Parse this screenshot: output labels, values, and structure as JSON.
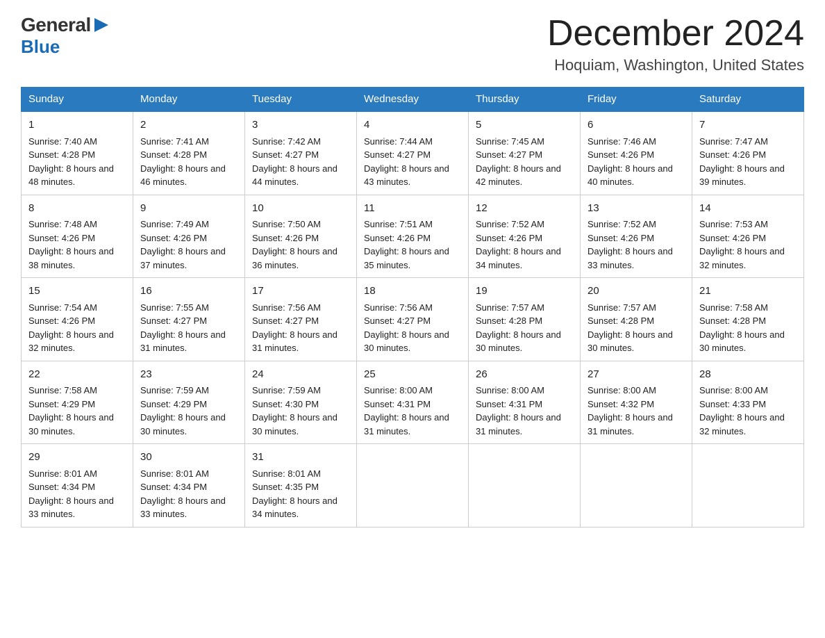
{
  "header": {
    "logo_general": "General",
    "logo_blue": "Blue",
    "month_title": "December 2024",
    "location": "Hoquiam, Washington, United States"
  },
  "days_of_week": [
    "Sunday",
    "Monday",
    "Tuesday",
    "Wednesday",
    "Thursday",
    "Friday",
    "Saturday"
  ],
  "weeks": [
    [
      {
        "day": "1",
        "sunrise": "7:40 AM",
        "sunset": "4:28 PM",
        "daylight": "8 hours and 48 minutes."
      },
      {
        "day": "2",
        "sunrise": "7:41 AM",
        "sunset": "4:28 PM",
        "daylight": "8 hours and 46 minutes."
      },
      {
        "day": "3",
        "sunrise": "7:42 AM",
        "sunset": "4:27 PM",
        "daylight": "8 hours and 44 minutes."
      },
      {
        "day": "4",
        "sunrise": "7:44 AM",
        "sunset": "4:27 PM",
        "daylight": "8 hours and 43 minutes."
      },
      {
        "day": "5",
        "sunrise": "7:45 AM",
        "sunset": "4:27 PM",
        "daylight": "8 hours and 42 minutes."
      },
      {
        "day": "6",
        "sunrise": "7:46 AM",
        "sunset": "4:26 PM",
        "daylight": "8 hours and 40 minutes."
      },
      {
        "day": "7",
        "sunrise": "7:47 AM",
        "sunset": "4:26 PM",
        "daylight": "8 hours and 39 minutes."
      }
    ],
    [
      {
        "day": "8",
        "sunrise": "7:48 AM",
        "sunset": "4:26 PM",
        "daylight": "8 hours and 38 minutes."
      },
      {
        "day": "9",
        "sunrise": "7:49 AM",
        "sunset": "4:26 PM",
        "daylight": "8 hours and 37 minutes."
      },
      {
        "day": "10",
        "sunrise": "7:50 AM",
        "sunset": "4:26 PM",
        "daylight": "8 hours and 36 minutes."
      },
      {
        "day": "11",
        "sunrise": "7:51 AM",
        "sunset": "4:26 PM",
        "daylight": "8 hours and 35 minutes."
      },
      {
        "day": "12",
        "sunrise": "7:52 AM",
        "sunset": "4:26 PM",
        "daylight": "8 hours and 34 minutes."
      },
      {
        "day": "13",
        "sunrise": "7:52 AM",
        "sunset": "4:26 PM",
        "daylight": "8 hours and 33 minutes."
      },
      {
        "day": "14",
        "sunrise": "7:53 AM",
        "sunset": "4:26 PM",
        "daylight": "8 hours and 32 minutes."
      }
    ],
    [
      {
        "day": "15",
        "sunrise": "7:54 AM",
        "sunset": "4:26 PM",
        "daylight": "8 hours and 32 minutes."
      },
      {
        "day": "16",
        "sunrise": "7:55 AM",
        "sunset": "4:27 PM",
        "daylight": "8 hours and 31 minutes."
      },
      {
        "day": "17",
        "sunrise": "7:56 AM",
        "sunset": "4:27 PM",
        "daylight": "8 hours and 31 minutes."
      },
      {
        "day": "18",
        "sunrise": "7:56 AM",
        "sunset": "4:27 PM",
        "daylight": "8 hours and 30 minutes."
      },
      {
        "day": "19",
        "sunrise": "7:57 AM",
        "sunset": "4:28 PM",
        "daylight": "8 hours and 30 minutes."
      },
      {
        "day": "20",
        "sunrise": "7:57 AM",
        "sunset": "4:28 PM",
        "daylight": "8 hours and 30 minutes."
      },
      {
        "day": "21",
        "sunrise": "7:58 AM",
        "sunset": "4:28 PM",
        "daylight": "8 hours and 30 minutes."
      }
    ],
    [
      {
        "day": "22",
        "sunrise": "7:58 AM",
        "sunset": "4:29 PM",
        "daylight": "8 hours and 30 minutes."
      },
      {
        "day": "23",
        "sunrise": "7:59 AM",
        "sunset": "4:29 PM",
        "daylight": "8 hours and 30 minutes."
      },
      {
        "day": "24",
        "sunrise": "7:59 AM",
        "sunset": "4:30 PM",
        "daylight": "8 hours and 30 minutes."
      },
      {
        "day": "25",
        "sunrise": "8:00 AM",
        "sunset": "4:31 PM",
        "daylight": "8 hours and 31 minutes."
      },
      {
        "day": "26",
        "sunrise": "8:00 AM",
        "sunset": "4:31 PM",
        "daylight": "8 hours and 31 minutes."
      },
      {
        "day": "27",
        "sunrise": "8:00 AM",
        "sunset": "4:32 PM",
        "daylight": "8 hours and 31 minutes."
      },
      {
        "day": "28",
        "sunrise": "8:00 AM",
        "sunset": "4:33 PM",
        "daylight": "8 hours and 32 minutes."
      }
    ],
    [
      {
        "day": "29",
        "sunrise": "8:01 AM",
        "sunset": "4:34 PM",
        "daylight": "8 hours and 33 minutes."
      },
      {
        "day": "30",
        "sunrise": "8:01 AM",
        "sunset": "4:34 PM",
        "daylight": "8 hours and 33 minutes."
      },
      {
        "day": "31",
        "sunrise": "8:01 AM",
        "sunset": "4:35 PM",
        "daylight": "8 hours and 34 minutes."
      },
      null,
      null,
      null,
      null
    ]
  ]
}
